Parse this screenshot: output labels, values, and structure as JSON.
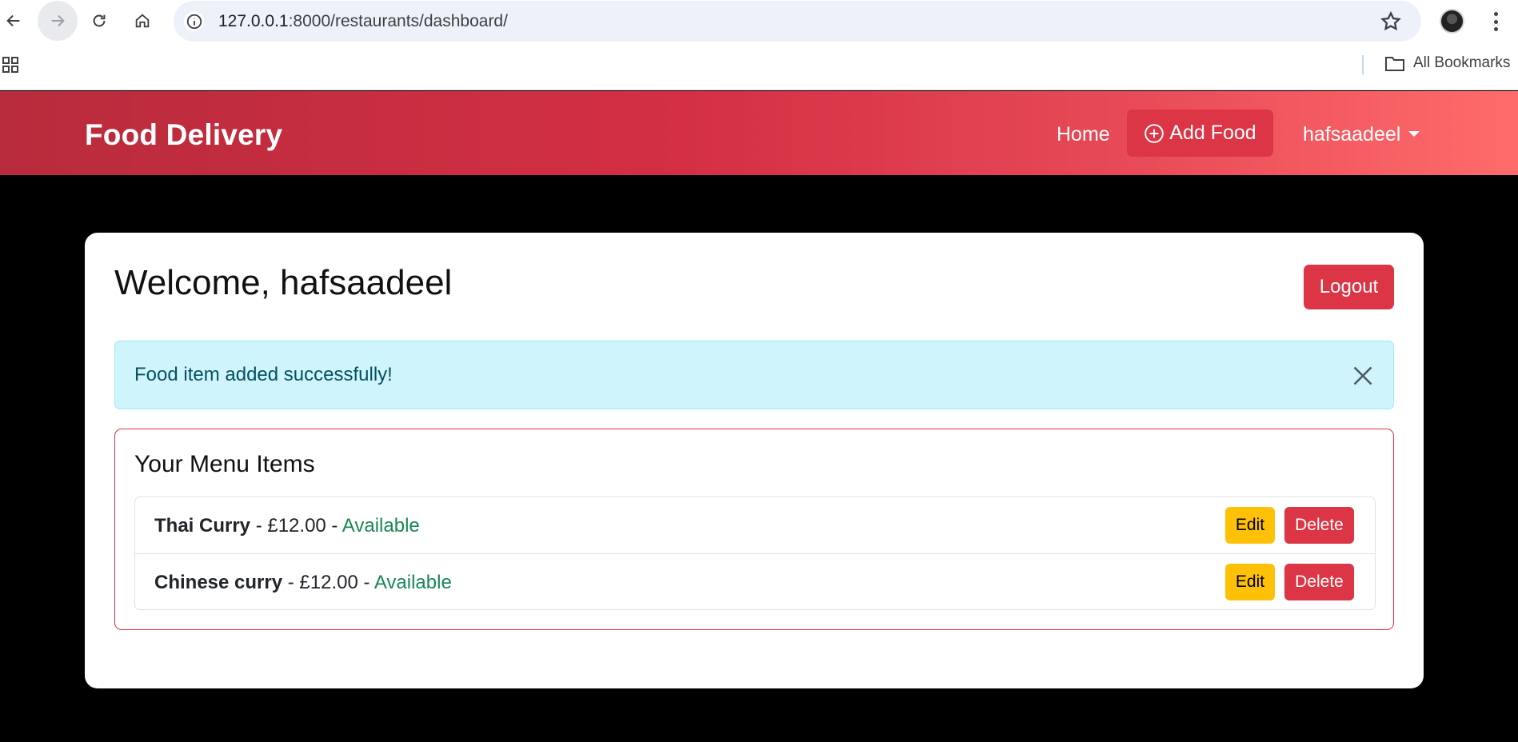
{
  "browser": {
    "url_host": "127.0.0.1",
    "url_path": ":8000/restaurants/dashboard/",
    "bookmarks_label": "All Bookmarks"
  },
  "navbar": {
    "brand": "Food Delivery",
    "home": "Home",
    "add_food": "Add Food",
    "username": "hafsaadeel",
    "gradient_start": "#b82b3c",
    "gradient_end": "#ff6b6b"
  },
  "dashboard": {
    "welcome": "Welcome, hafsaadeel",
    "logout": "Logout",
    "alert": "Food item added successfully!",
    "menu_heading": "Your Menu Items",
    "items": [
      {
        "name": "Thai Curry",
        "sep1": " - ",
        "price": "£12.00",
        "sep2": " - ",
        "status": "Available",
        "edit": "Edit",
        "delete": "Delete"
      },
      {
        "name": "Chinese curry",
        "sep1": " - ",
        "price": "£12.00",
        "sep2": " - ",
        "status": "Available",
        "edit": "Edit",
        "delete": "Delete"
      }
    ]
  },
  "colors": {
    "danger": "#dc3545",
    "warning": "#ffc107",
    "success": "#198754",
    "info_bg": "#cff4fc"
  },
  "icons": [
    "back-arrow-icon",
    "forward-arrow-icon",
    "reload-icon",
    "home-icon",
    "site-info-icon",
    "star-icon",
    "kebab-menu-icon",
    "apps-grid-icon",
    "folder-icon",
    "plus-circle-icon",
    "caret-down-icon",
    "close-icon"
  ]
}
